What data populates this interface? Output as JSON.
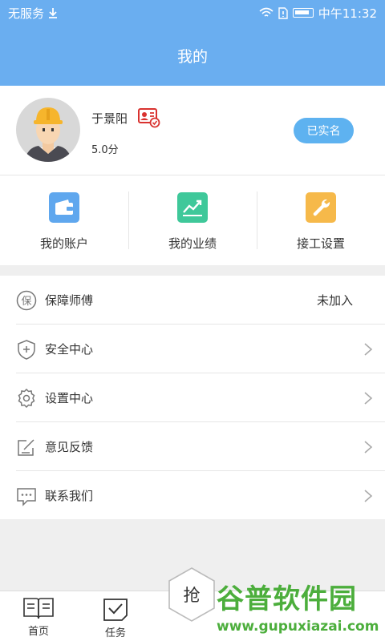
{
  "status_bar": {
    "carrier": "无服务",
    "time": "中午11:32"
  },
  "header": {
    "title": "我的"
  },
  "profile": {
    "name": "于景阳",
    "score": "5.0分",
    "verified_label": "已实名"
  },
  "shortcuts": [
    {
      "label": "我的账户",
      "icon": "wallet-icon",
      "color": "#5fa7ee"
    },
    {
      "label": "我的业绩",
      "icon": "trend-chart-icon",
      "color": "#3fc89a"
    },
    {
      "label": "接工设置",
      "icon": "wrench-icon",
      "color": "#f6b94a"
    }
  ],
  "menu": [
    {
      "label": "保障师傅",
      "icon": "guarantee-icon",
      "value": "未加入"
    },
    {
      "label": "安全中心",
      "icon": "shield-icon"
    },
    {
      "label": "设置中心",
      "icon": "gear-icon"
    },
    {
      "label": "意见反馈",
      "icon": "feedback-icon"
    },
    {
      "label": "联系我们",
      "icon": "chat-icon"
    }
  ],
  "menu_icon_badge": "保",
  "tabbar": {
    "tabs": [
      {
        "label": "首页",
        "icon": "book-icon"
      },
      {
        "label": "任务",
        "icon": "checkbox-icon"
      }
    ],
    "grab_label": "抢"
  },
  "watermark": {
    "title": "谷普软件园",
    "url": "www.gupuxiazai.com"
  }
}
